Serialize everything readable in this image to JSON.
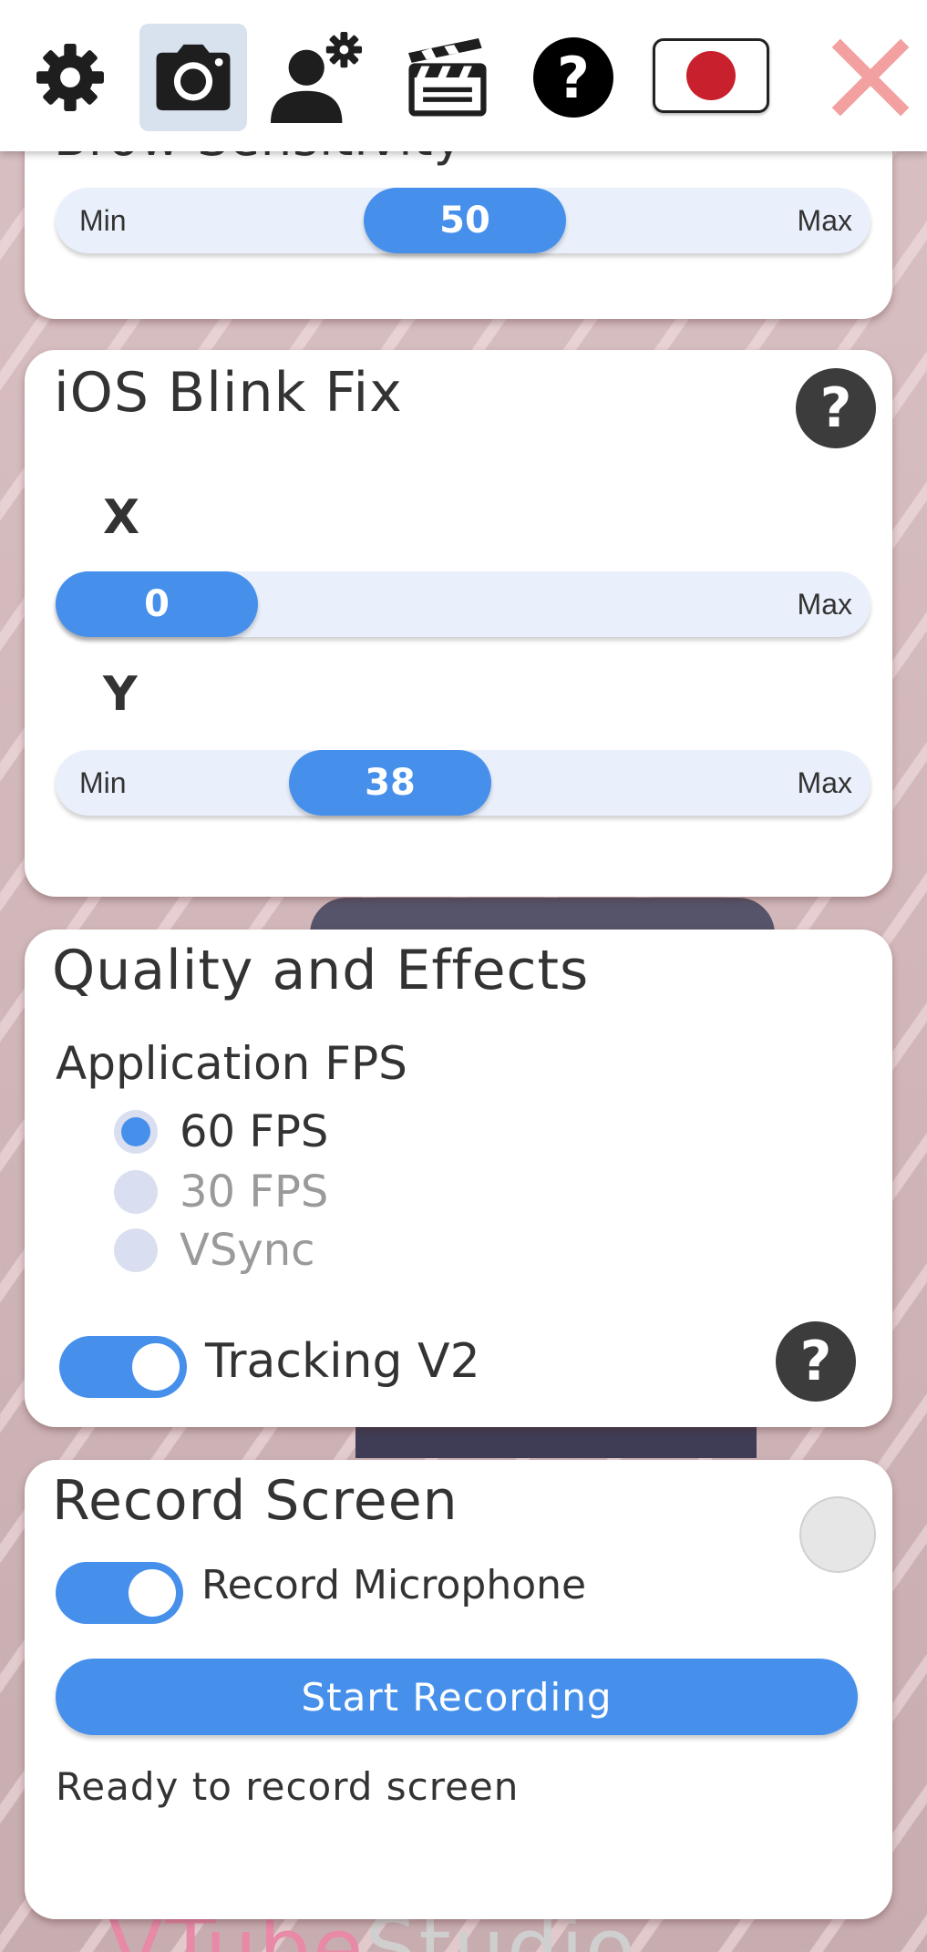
{
  "toolbar": {
    "icons": [
      "gear-icon",
      "camera-icon",
      "user-settings-icon",
      "clapperboard-icon",
      "help-icon",
      "japan-flag-icon",
      "close-icon"
    ],
    "active": "camera-icon",
    "close_color": "#f2a0a0"
  },
  "brow_card": {
    "title": "Brow Sensitivity",
    "slider": {
      "min_label": "Min",
      "max_label": "Max",
      "value": "50"
    }
  },
  "blink_card": {
    "title": "iOS Blink Fix",
    "help": "?",
    "x_label": "X",
    "x_slider": {
      "max_label": "Max",
      "value": "0"
    },
    "y_label": "Y",
    "y_slider": {
      "min_label": "Min",
      "max_label": "Max",
      "value": "38"
    }
  },
  "quality_card": {
    "title": "Quality and Effects",
    "fps_heading": "Application FPS",
    "fps_options": [
      {
        "label": "60 FPS",
        "selected": true
      },
      {
        "label": "30 FPS",
        "selected": false
      },
      {
        "label": "VSync",
        "selected": false
      }
    ],
    "tracking_label": "Tracking V2",
    "tracking_on": true,
    "help": "?"
  },
  "record_card": {
    "title": "Record Screen",
    "mic_label": "Record Microphone",
    "mic_on": true,
    "start_button": "Start Recording",
    "status": "Ready to record screen"
  },
  "background": {
    "logo_a": "VTube",
    "logo_b": "Studio"
  },
  "colors": {
    "accent": "#4690ec",
    "card": "#ffffff",
    "text": "#333333"
  }
}
